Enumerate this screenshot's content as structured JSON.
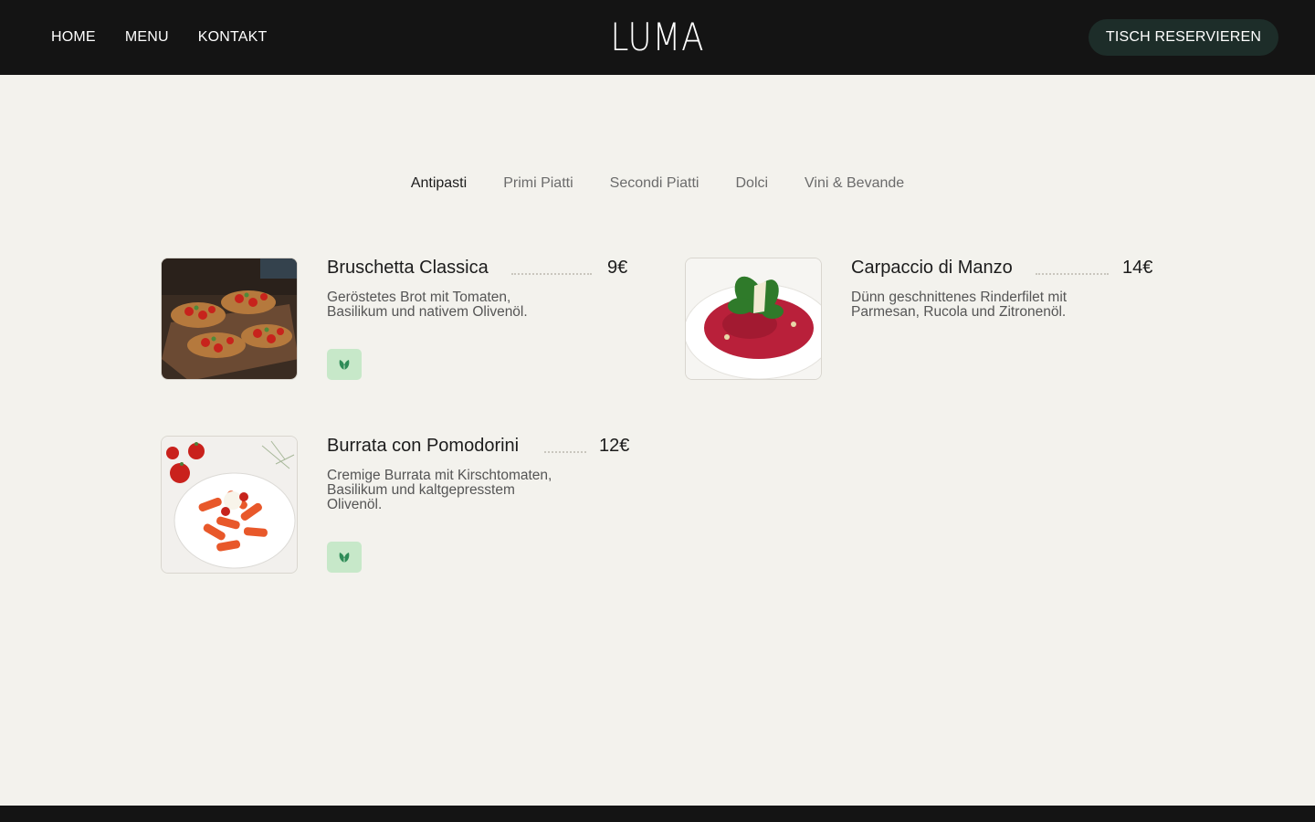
{
  "nav": {
    "home": "HOME",
    "menu": "MENU",
    "kontakt": "KONTAKT"
  },
  "logo": "LUMA",
  "reserve_button": "TISCH RESERVIEREN",
  "tabs": [
    "Antipasti",
    "Primi Piatti",
    "Secondi Piatti",
    "Dolci",
    "Vini & Bevande"
  ],
  "active_tab": "Antipasti",
  "items": [
    {
      "name": "Bruschetta Classica",
      "price": "9€",
      "description": "Geröstetes Brot mit Tomaten, Basilikum und nativem Olivenöl.",
      "image": "bruschetta-image",
      "vegetarian": true
    },
    {
      "name": "Carpaccio di Manzo",
      "price": "14€",
      "description": "Dünn geschnittenes Rinderfilet mit Parmesan, Rucola und Zitronenöl.",
      "image": "carpaccio-image",
      "vegetarian": false
    },
    {
      "name": "Burrata con Pomodorini",
      "price": "12€",
      "description": "Cremige Burrata mit Kirschtomaten, Basilikum und kaltgepresstem Olivenöl.",
      "image": "burrata-pasta-image",
      "vegetarian": true
    }
  ],
  "colors": {
    "header_bg": "#141414",
    "page_bg": "#f3f2ed",
    "button_bg": "#1d2d29",
    "veg_badge_bg": "#c7e8c9",
    "veg_icon": "#2e8b57"
  }
}
